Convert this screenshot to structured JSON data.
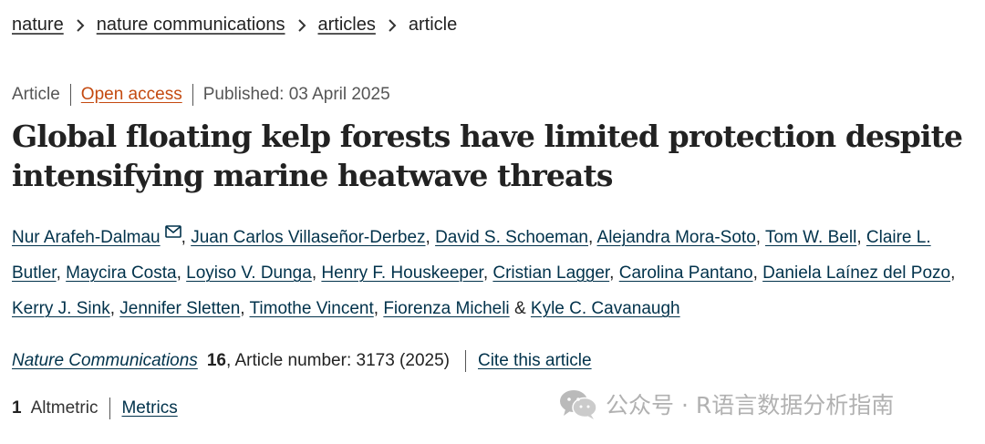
{
  "breadcrumb": {
    "items": [
      {
        "label": "nature"
      },
      {
        "label": "nature communications"
      },
      {
        "label": "articles"
      },
      {
        "label": "article"
      }
    ],
    "separator_icon": "chevron-right-icon"
  },
  "meta": {
    "type": "Article",
    "access": "Open access",
    "published": "Published: 03 April 2025",
    "access_color": "#c44a10"
  },
  "title": {
    "line1": "Global floating kelp forests have limited protection despite",
    "line2": "intensifying marine heatwave threats"
  },
  "authors": {
    "list": [
      "Nur Arafeh-Dalmau",
      "Juan Carlos Villaseñor-Derbez",
      "David S. Schoeman",
      "Alejandra Mora-Soto",
      "Tom W. Bell",
      "Claire L. Butler",
      "Maycira Costa",
      "Loyiso V. Dunga",
      "Henry F. Houskeeper",
      "Cristian Lagger",
      "Carolina Pantano",
      "Daniela Laínez del Pozo",
      "Kerry J. Sink",
      "Jennifer Sletten",
      "Timothe Vincent",
      "Fiorenza Micheli",
      "Kyle C. Cavanaugh"
    ],
    "comma": ",",
    "ampersand": "&",
    "corresponding_icon": "mail-icon",
    "link_color": "#01324b"
  },
  "citation": {
    "journal": "Nature Communications",
    "volume": "16",
    "article_number": ", Article number: 3173 (2025)",
    "cite_label": "Cite this article"
  },
  "metrics": {
    "altmetric_count": "1",
    "altmetric_label": "Altmetric",
    "metrics_label": "Metrics"
  },
  "watermark": {
    "text": "公众号 · R语言数据分析指南",
    "icon": "wechat-icon"
  }
}
